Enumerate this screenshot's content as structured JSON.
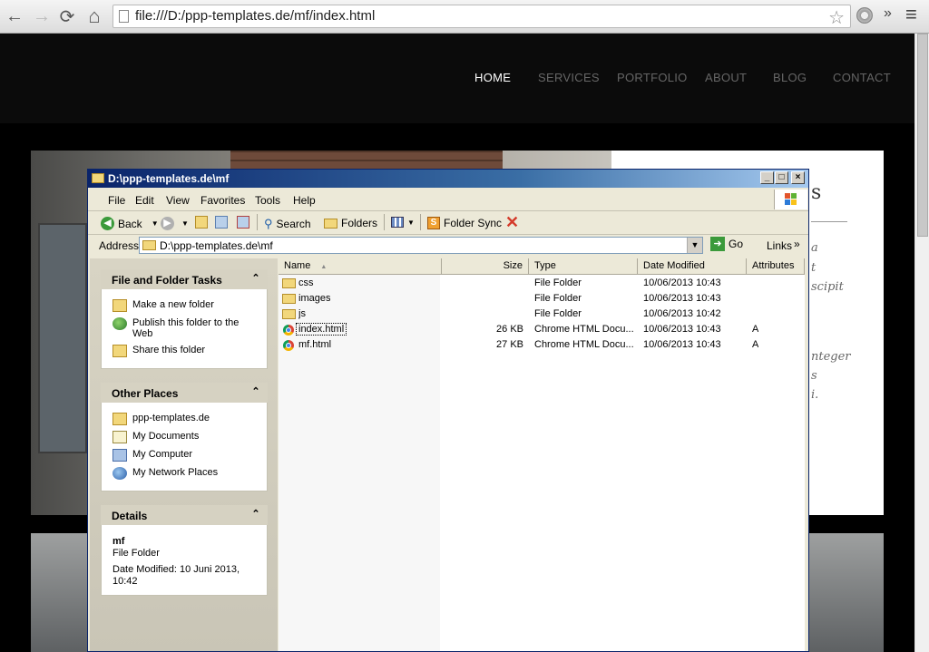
{
  "browser": {
    "url": "file:///D:/ppp-templates.de/mf/index.html",
    "icons": {
      "back": "back-arrow-icon",
      "forward": "forward-arrow-icon",
      "reload": "reload-icon",
      "home": "home-icon",
      "star": "star-icon",
      "extension": "extension-icon",
      "more": "chevron-right-double-icon",
      "menu": "hamburger-menu-icon"
    },
    "back_glyph": "←",
    "forward_glyph": "→",
    "reload_glyph": "⟳",
    "home_glyph": "⌂",
    "star_glyph": "☆",
    "more_glyph": "»",
    "menu_glyph": "≡"
  },
  "site": {
    "nav": [
      "HOME",
      "SERVICES",
      "PORTFOLIO",
      "ABOUT",
      "BLOG",
      "CONTACT"
    ],
    "card_fragments": [
      "s",
      "a",
      "t",
      "scipit",
      "nteger",
      "s",
      "i."
    ]
  },
  "explorer": {
    "title": "D:\\ppp-templates.de\\mf",
    "menu": [
      "File",
      "Edit",
      "View",
      "Favorites",
      "Tools",
      "Help"
    ],
    "toolbar": {
      "back": "Back",
      "search": "Search",
      "folders": "Folders",
      "folder_sync": "Folder Sync"
    },
    "address_label": "Address",
    "address_value": "D:\\ppp-templates.de\\mf",
    "go": "Go",
    "links": "Links",
    "links_more": "»",
    "title_buttons": {
      "minimize": "_",
      "maximize": "□",
      "close": "×"
    },
    "tasks": {
      "file_folder": {
        "title": "File and Folder Tasks",
        "items": [
          "Make a new folder",
          "Publish this folder to the Web",
          "Share this folder"
        ]
      },
      "other_places": {
        "title": "Other Places",
        "items": [
          "ppp-templates.de",
          "My Documents",
          "My Computer",
          "My Network Places"
        ]
      },
      "details": {
        "title": "Details",
        "name": "mf",
        "type": "File Folder",
        "modified": "Date Modified: 10 Juni 2013, 10:42"
      }
    },
    "chevron": "⌃",
    "columns": [
      "Name",
      "Size",
      "Type",
      "Date Modified",
      "Attributes"
    ],
    "files": [
      {
        "name": "css",
        "size": "",
        "type": "File Folder",
        "date": "10/06/2013 10:43",
        "attr": "",
        "kind": "folder"
      },
      {
        "name": "images",
        "size": "",
        "type": "File Folder",
        "date": "10/06/2013 10:43",
        "attr": "",
        "kind": "folder"
      },
      {
        "name": "js",
        "size": "",
        "type": "File Folder",
        "date": "10/06/2013 10:42",
        "attr": "",
        "kind": "folder"
      },
      {
        "name": "index.html",
        "size": "26 KB",
        "type": "Chrome HTML Docu...",
        "date": "10/06/2013 10:43",
        "attr": "A",
        "kind": "chrome"
      },
      {
        "name": "mf.html",
        "size": "27 KB",
        "type": "Chrome HTML Docu...",
        "date": "10/06/2013 10:43",
        "attr": "A",
        "kind": "chrome"
      }
    ]
  }
}
